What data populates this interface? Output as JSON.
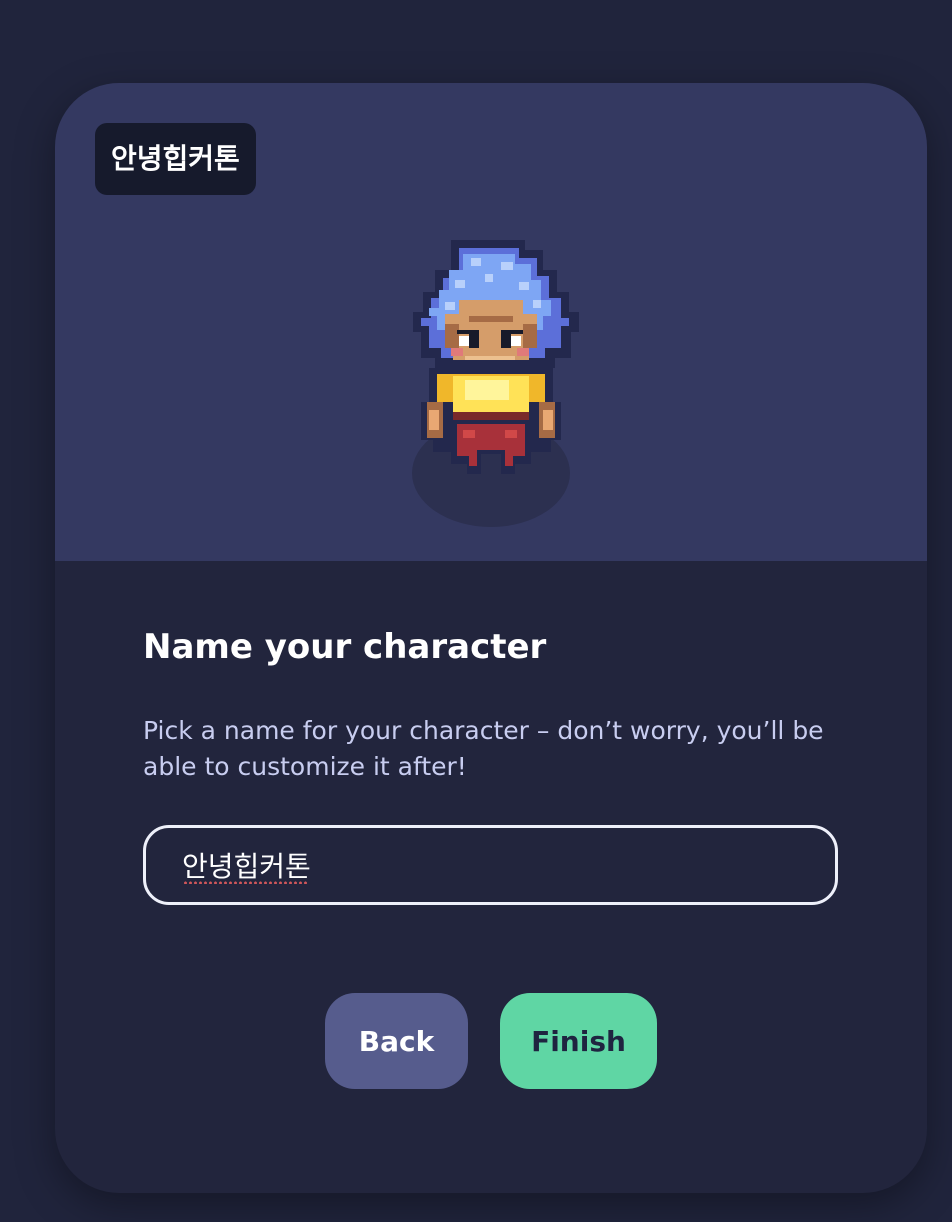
{
  "preview": {
    "name_tag": "안녕힙커톤"
  },
  "form": {
    "title": "Name your character",
    "description": "Pick a name for your character – don’t worry, you’ll be able to customize it after!",
    "name_value": "안녕힙커톤"
  },
  "actions": {
    "back_label": "Back",
    "finish_label": "Finish"
  },
  "colors": {
    "background": "#20243c",
    "preview_bg": "#343961",
    "back_button": "#565c8d",
    "finish_button": "#5fd6a4",
    "hair": "#7ea6f4",
    "shirt": "#ffe257",
    "pants": "#a8313a"
  },
  "icons": {
    "avatar": "pixel-character-avatar"
  }
}
